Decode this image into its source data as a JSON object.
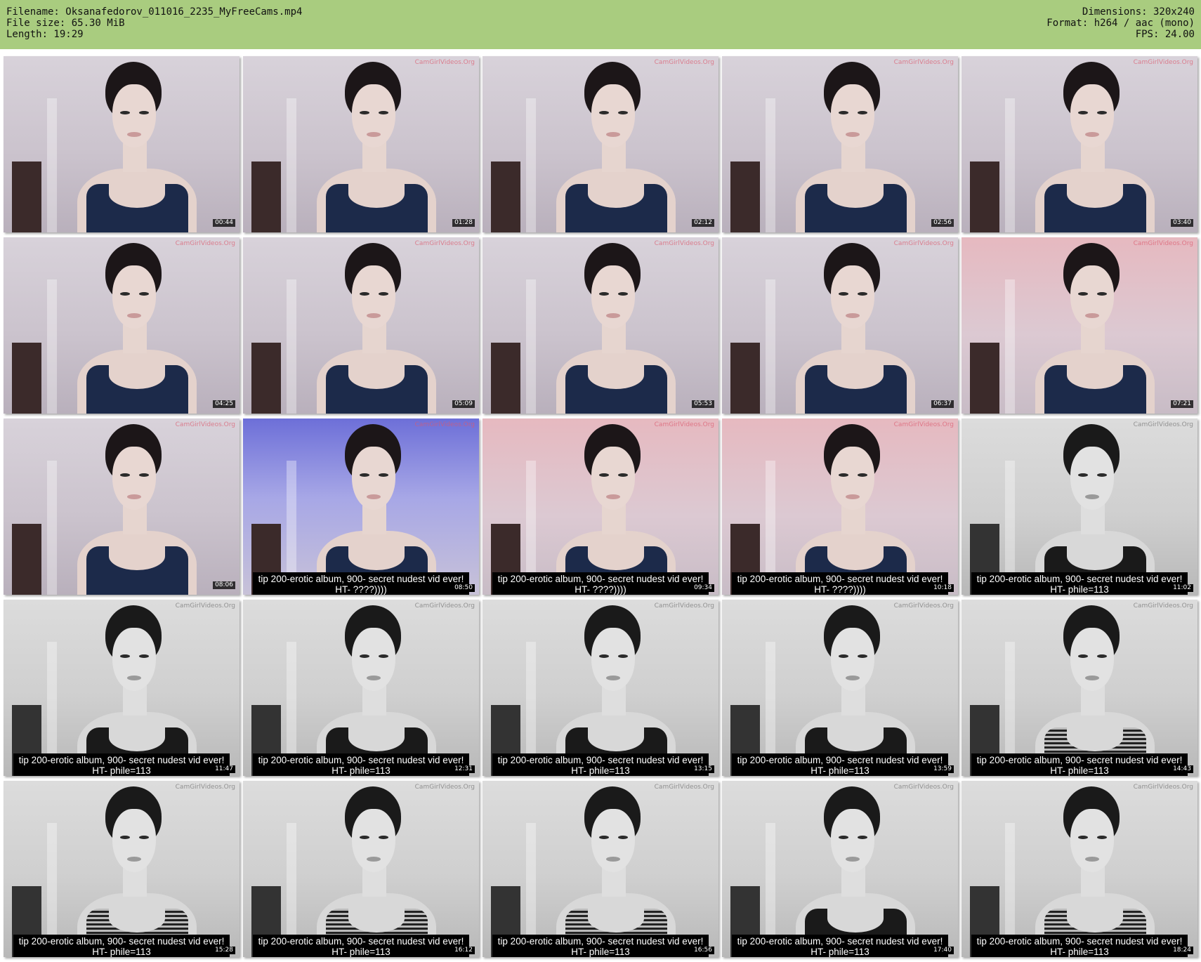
{
  "header": {
    "filename_label": "Filename: Oksanafedorov_011016_2235_MyFreeCams.mp4",
    "filesize_label": "File size: 65.30 MiB",
    "length_label": "Length: 19:29",
    "dimensions_label": "Dimensions: 320x240",
    "format_label": "Format: h264 / aac (mono)",
    "fps_label": "FPS: 24.00",
    "background_color": "#a9cc7f"
  },
  "watermark": "CamGirlVideos.Org",
  "thumbnails": [
    {
      "timestamp": "00:44",
      "tone": "color",
      "caption": ""
    },
    {
      "timestamp": "01:28",
      "tone": "color",
      "caption": ""
    },
    {
      "timestamp": "02:12",
      "tone": "color",
      "caption": ""
    },
    {
      "timestamp": "02:56",
      "tone": "color",
      "caption": ""
    },
    {
      "timestamp": "03:40",
      "tone": "color",
      "caption": ""
    },
    {
      "timestamp": "04:25",
      "tone": "color",
      "caption": ""
    },
    {
      "timestamp": "05:09",
      "tone": "color",
      "caption": ""
    },
    {
      "timestamp": "05:53",
      "tone": "color",
      "caption": ""
    },
    {
      "timestamp": "06:37",
      "tone": "color",
      "caption": ""
    },
    {
      "timestamp": "07:21",
      "tone": "pink",
      "caption": ""
    },
    {
      "timestamp": "08:06",
      "tone": "color",
      "caption": ""
    },
    {
      "timestamp": "08:50",
      "tone": "blue",
      "caption": "tip 200-erotic album, 900- secret nudest vid ever! HT- ????))))"
    },
    {
      "timestamp": "09:34",
      "tone": "pink",
      "caption": "tip 200-erotic album, 900- secret nudest vid ever! HT- ????))))"
    },
    {
      "timestamp": "10:18",
      "tone": "pink",
      "caption": "tip 200-erotic album, 900- secret nudest vid ever! HT- ????))))"
    },
    {
      "timestamp": "11:02",
      "tone": "gray",
      "caption": "tip 200-erotic album, 900- secret nudest vid ever! HT- phile=113"
    },
    {
      "timestamp": "11:47",
      "tone": "gray",
      "caption": "tip 200-erotic album, 900- secret nudest vid ever! HT- phile=113"
    },
    {
      "timestamp": "12:31",
      "tone": "gray",
      "caption": "tip 200-erotic album, 900- secret nudest vid ever! HT- phile=113"
    },
    {
      "timestamp": "13:15",
      "tone": "gray",
      "caption": "tip 200-erotic album, 900- secret nudest vid ever! HT- phile=113"
    },
    {
      "timestamp": "13:59",
      "tone": "gray",
      "caption": "tip 200-erotic album, 900- secret nudest vid ever! HT- phile=113"
    },
    {
      "timestamp": "14:43",
      "tone": "gray-stripes",
      "caption": "tip 200-erotic album, 900- secret nudest vid ever! HT- phile=113"
    },
    {
      "timestamp": "15:28",
      "tone": "gray-stripes",
      "caption": "tip 200-erotic album, 900- secret nudest vid ever! HT- phile=113"
    },
    {
      "timestamp": "16:12",
      "tone": "gray-stripes",
      "caption": "tip 200-erotic album, 900- secret nudest vid ever! HT- phile=113"
    },
    {
      "timestamp": "16:56",
      "tone": "gray-stripes",
      "caption": "tip 200-erotic album, 900- secret nudest vid ever! HT- phile=113"
    },
    {
      "timestamp": "17:40",
      "tone": "gray",
      "caption": "tip 200-erotic album, 900- secret nudest vid ever! HT- phile=113"
    },
    {
      "timestamp": "18:24",
      "tone": "gray-stripes",
      "caption": "tip 200-erotic album, 900- secret nudest vid ever! HT- phile=113"
    }
  ]
}
